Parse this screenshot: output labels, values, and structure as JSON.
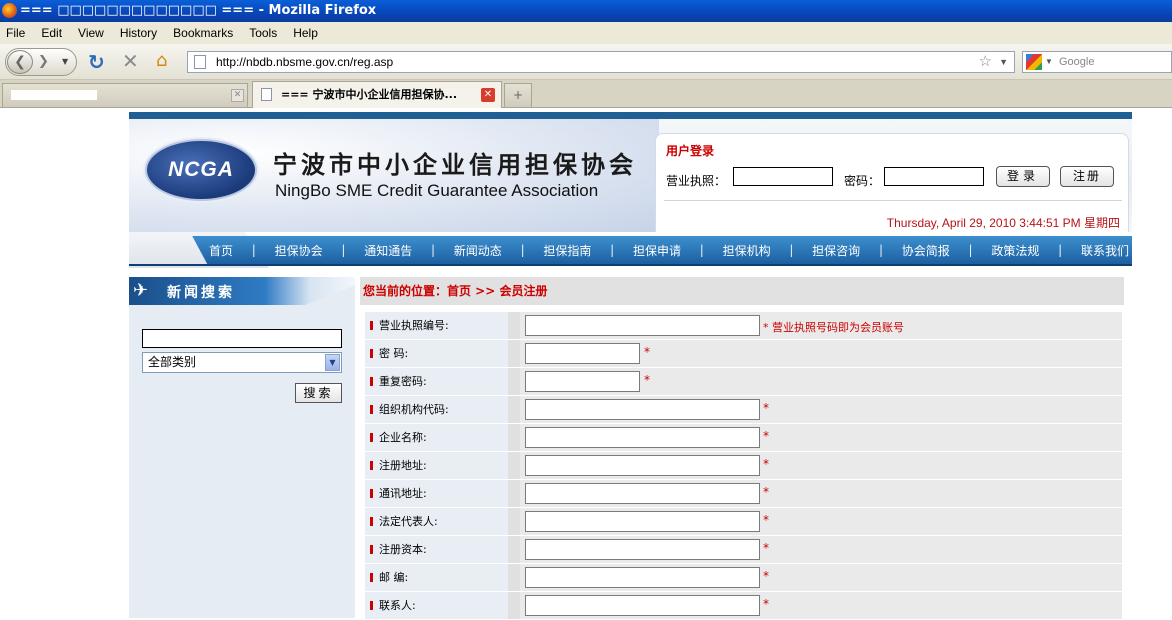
{
  "window": {
    "title": "=== □□□□□□□□□□□□□ === - Mozilla Firefox"
  },
  "menu": [
    "File",
    "Edit",
    "View",
    "History",
    "Bookmarks",
    "Tools",
    "Help"
  ],
  "toolbar": {
    "url": "http://nbdb.nbsme.gov.cn/reg.asp",
    "search_placeholder": "Google"
  },
  "tabs": {
    "active_label": "=== 宁波市中小企业信用担保协...",
    "new_tab": "+"
  },
  "site": {
    "logo_abbr": "NCGA",
    "name_cn": "宁波市中小企业信用担保协会",
    "name_en": "NingBo SME Credit Guarantee Association"
  },
  "login": {
    "title": "用户登录",
    "license_label": "营业执照：",
    "password_label": "密码：",
    "login_button": "登录",
    "register_button": "注册",
    "datetime": "Thursday, April 29, 2010 3:44:51 PM 星期四"
  },
  "nav": [
    "首页",
    "担保协会",
    "通知通告",
    "新闻动态",
    "担保指南",
    "担保申请",
    "担保机构",
    "担保咨询",
    "协会简报",
    "政策法规",
    "联系我们"
  ],
  "sidebar": {
    "title": "新闻搜索",
    "category_selected": "全部类别",
    "search_button": "搜索"
  },
  "breadcrumb": "您当前的位置：首页 >> 会员注册",
  "form": {
    "note_license": "* 营业执照号码即为会员账号",
    "req_mark": "*",
    "fields": [
      {
        "label": "营业执照编号:"
      },
      {
        "label": "密 码:"
      },
      {
        "label": "重复密码:"
      },
      {
        "label": "组织机构代码:"
      },
      {
        "label": "企业名称:"
      },
      {
        "label": "注册地址:"
      },
      {
        "label": "通讯地址:"
      },
      {
        "label": "法定代表人:"
      },
      {
        "label": "注册资本:"
      },
      {
        "label": "邮 编:"
      },
      {
        "label": "联系人:"
      }
    ]
  },
  "colors": {
    "accent_red": "#cc0000",
    "nav_blue": "#1c5fa2",
    "title_bar_blue": "#0845b8"
  }
}
